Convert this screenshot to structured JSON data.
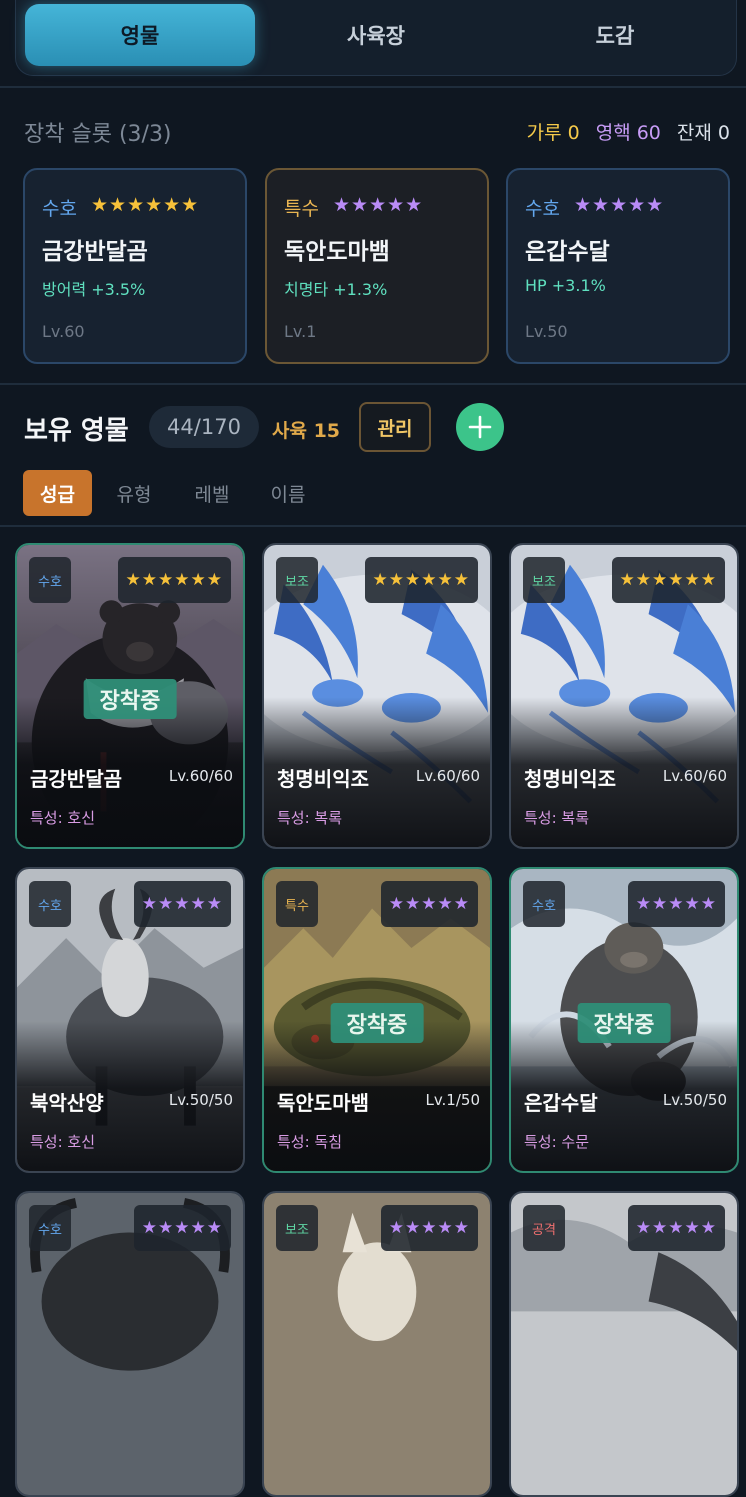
{
  "tabs": [
    {
      "label": "영물",
      "active": true
    },
    {
      "label": "사육장",
      "active": false
    },
    {
      "label": "도감",
      "active": false
    }
  ],
  "equip": {
    "title": "장착 슬롯 (3/3)",
    "currency": {
      "powder": "가루 0",
      "essence": "영핵 60",
      "material": "잔재 0"
    },
    "slots": [
      {
        "type": "수호",
        "stars": "★★★★★★",
        "name": "금강반달곰",
        "stat": "방어력 +3.5%",
        "level": "Lv.60"
      },
      {
        "type": "특수",
        "stars": "★★★★★",
        "name": "독안도마뱀",
        "stat": "치명타 +1.3%",
        "level": "Lv.1"
      },
      {
        "type": "수호",
        "stars": "★★★★★",
        "name": "은갑수달",
        "stat": "HP +3.1%",
        "level": "Lv.50"
      }
    ]
  },
  "owned": {
    "title": "보유 영물",
    "count": "44/170",
    "breeding": "사육 15",
    "manage_label": "관리",
    "sort_tabs": [
      "성급",
      "유형",
      "레벨",
      "이름"
    ],
    "equipped_label": "장착중",
    "cards": [
      {
        "type": "수호",
        "stars": "★★★★★★",
        "name": "금강반달곰",
        "level": "Lv.60/60",
        "trait": "특성: 호신"
      },
      {
        "type": "보조",
        "stars": "★★★★★★",
        "name": "청명비익조",
        "level": "Lv.60/60",
        "trait": "특성: 복록"
      },
      {
        "type": "보조",
        "stars": "★★★★★★",
        "name": "청명비익조",
        "level": "Lv.60/60",
        "trait": "특성: 복록"
      },
      {
        "type": "수호",
        "stars": "★★★★★",
        "name": "북악산양",
        "level": "Lv.50/50",
        "trait": "특성: 호신"
      },
      {
        "type": "특수",
        "stars": "★★★★★",
        "name": "독안도마뱀",
        "level": "Lv.1/50",
        "trait": "특성: 독침"
      },
      {
        "type": "수호",
        "stars": "★★★★★",
        "name": "은갑수달",
        "level": "Lv.50/50",
        "trait": "특성: 수문"
      },
      {
        "type": "수호",
        "stars": "★★★★★"
      },
      {
        "type": "보조",
        "stars": "★★★★★"
      },
      {
        "type": "공격",
        "stars": "★★★★★"
      }
    ]
  },
  "colors": {
    "accent": "#45b5d8",
    "equipped": "#2f8f78",
    "sort_active": "#c8742c",
    "add": "#3cc48a"
  }
}
